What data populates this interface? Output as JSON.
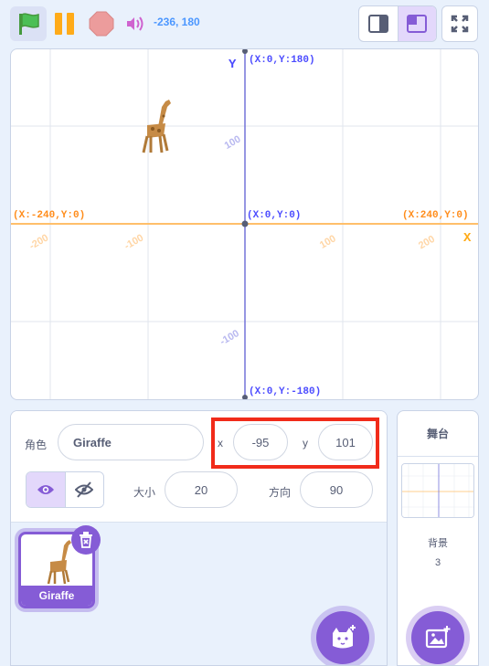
{
  "toolbar": {
    "flag_icon": "green-flag-icon",
    "pause_icon": "pause-icon",
    "stop_icon": "stop-icon",
    "turbo_icon": "speaker-icon",
    "mouse_coords": "-236, 180",
    "colors": {
      "flag": "#4cbf56",
      "pause": "#ffab19",
      "stop": "#ec9c9c",
      "coords": "#4c97ff"
    }
  },
  "stage": {
    "axis_y_label": "Y",
    "axis_x_label": "X",
    "top_label": "(X:0,Y:180)",
    "bottom_label": "(X:0,Y:-180)",
    "left_label": "(X:-240,Y:0)",
    "right_label": "(X:240,Y:0)",
    "center_label": "(X:0,Y:0)",
    "x_ticks": [
      "-200",
      "-100",
      "100",
      "200"
    ],
    "y_ticks": [
      "100",
      "-100"
    ],
    "colors": {
      "x_axis": "#ffbf6a",
      "y_axis": "#7373d9",
      "grid": "#e1e6ee",
      "label_orange": "#ff8c1a",
      "label_blue": "#4c4cff"
    }
  },
  "sprite_info": {
    "sprite_label": "角色",
    "sprite_name": "Giraffe",
    "x_label": "x",
    "x_value": "-95",
    "y_label": "y",
    "y_value": "101",
    "size_label": "大小",
    "size_value": "20",
    "direction_label": "方向",
    "direction_value": "90",
    "show_icon": "eye-icon",
    "hide_icon": "eye-slash-icon"
  },
  "sprite_list": {
    "items": [
      {
        "name": "Giraffe"
      }
    ],
    "delete_icon": "trash-icon",
    "add_sprite_icon": "cat-plus-icon"
  },
  "stage_pane": {
    "title": "舞台",
    "backdrop_label": "背景",
    "backdrop_count": "3",
    "add_backdrop_icon": "image-plus-icon"
  },
  "accent": "#855cd6"
}
